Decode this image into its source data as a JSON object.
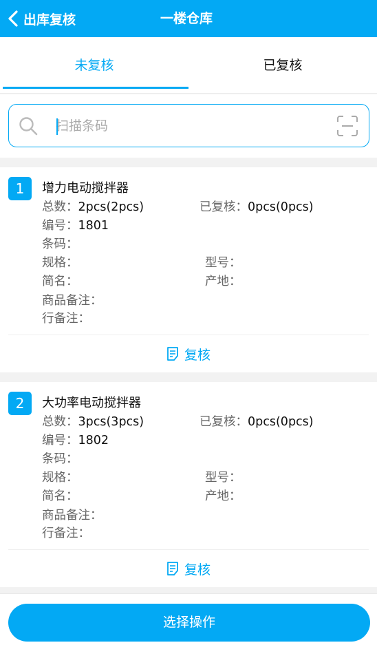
{
  "header": {
    "back_label": "出库复核",
    "title": "一楼仓库"
  },
  "tabs": [
    {
      "label": "未复核",
      "active": true
    },
    {
      "label": "已复核",
      "active": false
    }
  ],
  "search": {
    "placeholder": "扫描条码",
    "value": ""
  },
  "labels": {
    "total": "总数：",
    "reviewed": "已复核：",
    "code": "编号：",
    "barcode": "条码：",
    "spec": "规格：",
    "model": "型号：",
    "short_name": "简名：",
    "origin": "产地：",
    "product_note": "商品备注：",
    "line_note": "行备注：",
    "review_button": "复核"
  },
  "items": [
    {
      "index": "1",
      "name": "增力电动搅拌器",
      "total": "2pcs(2pcs)",
      "reviewed": "0pcs(0pcs)",
      "code": "1801",
      "barcode": "",
      "spec": "",
      "model": "",
      "short_name": "",
      "origin": "",
      "product_note": "",
      "line_note": ""
    },
    {
      "index": "2",
      "name": "大功率电动搅拌器",
      "total": "3pcs(3pcs)",
      "reviewed": "0pcs(0pcs)",
      "code": "1802",
      "barcode": "",
      "spec": "",
      "model": "",
      "short_name": "",
      "origin": "",
      "product_note": "",
      "line_note": ""
    }
  ],
  "bottom": {
    "action_label": "选择操作"
  },
  "colors": {
    "accent": "#03a9f4",
    "background": "#f2f2f2"
  }
}
